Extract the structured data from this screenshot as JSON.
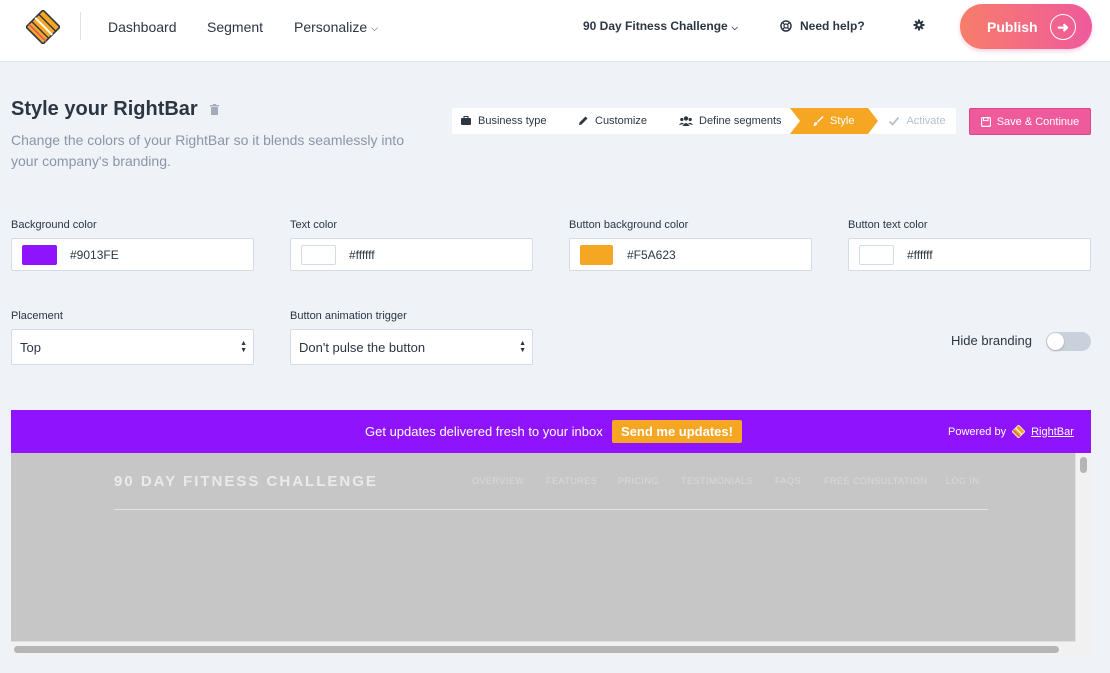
{
  "nav": {
    "dashboard": "Dashboard",
    "segment": "Segment",
    "personalize": "Personalize",
    "project": "90 Day Fitness Challenge",
    "help": "Need help?",
    "publish": "Publish"
  },
  "header": {
    "title": "Style your RightBar",
    "subtitle": "Change the colors of your RightBar so it blends seamlessly into your company's branding."
  },
  "stepper": {
    "steps": [
      {
        "label": "Business type",
        "icon": "briefcase-icon"
      },
      {
        "label": "Customize",
        "icon": "pencil-icon"
      },
      {
        "label": "Define segments",
        "icon": "users-icon"
      },
      {
        "label": "Style",
        "icon": "brush-icon",
        "state": "active"
      },
      {
        "label": "Activate",
        "icon": "check-icon",
        "state": "disabled"
      }
    ],
    "save_label": "Save & Continue"
  },
  "form": {
    "background_color": {
      "label": "Background color",
      "value": "#9013FE"
    },
    "text_color": {
      "label": "Text color",
      "value": "#ffffff"
    },
    "button_background_color": {
      "label": "Button background color",
      "value": "#F5A623"
    },
    "button_text_color": {
      "label": "Button text color",
      "value": "#ffffff"
    },
    "placement": {
      "label": "Placement",
      "value": "Top"
    },
    "animation_trigger": {
      "label": "Button animation trigger",
      "value": "Don't pulse the button"
    },
    "hide_branding": {
      "label": "Hide branding",
      "enabled": false
    }
  },
  "preview": {
    "bar_text": "Get updates delivered fresh to your inbox",
    "bar_button": "Send me updates!",
    "powered_by": "Powered by",
    "brand": "RightBar",
    "site_title": "90 DAY FITNESS CHALLENGE",
    "site_nav": [
      "OVERVIEW",
      "FEATURES",
      "PRICING",
      "TESTIMONIALS",
      "FAQS",
      "FREE CONSULTATION",
      "LOG IN"
    ]
  },
  "colors": {
    "accent_purple": "#9013fe",
    "accent_orange": "#f5a623",
    "accent_pink": "#ef5a9c"
  }
}
